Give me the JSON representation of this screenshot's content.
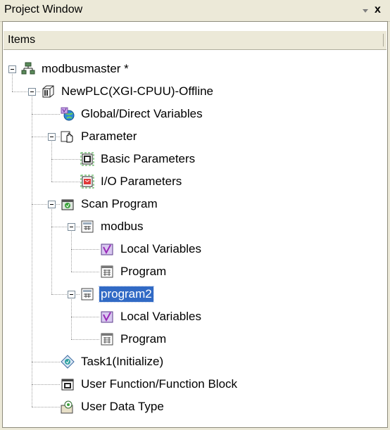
{
  "window": {
    "title": "Project Window",
    "close_glyph": "x",
    "pin_icon": "pin-dropdown-icon"
  },
  "header": {
    "items_label": "Items"
  },
  "tree": {
    "nodes": [
      {
        "id": "modbusmaster",
        "label": "modbusmaster *",
        "icon": "network-icon",
        "level": 0,
        "expanded": true
      },
      {
        "id": "newplc",
        "label": "NewPLC(XGI-CPUU)-Offline",
        "icon": "plc-icon",
        "level": 1,
        "expanded": true
      },
      {
        "id": "global-vars",
        "label": "Global/Direct Variables",
        "icon": "global-variables-icon",
        "level": 2
      },
      {
        "id": "parameter",
        "label": "Parameter",
        "icon": "parameter-hand-icon",
        "level": 2,
        "expanded": true
      },
      {
        "id": "basic-params",
        "label": "Basic Parameters",
        "icon": "basic-parameters-icon",
        "level": 3
      },
      {
        "id": "io-params",
        "label": "I/O Parameters",
        "icon": "io-parameters-icon",
        "level": 3
      },
      {
        "id": "scan-program",
        "label": "Scan Program",
        "icon": "scan-program-icon",
        "level": 2,
        "expanded": true
      },
      {
        "id": "modbus",
        "label": "modbus",
        "icon": "program-block-icon",
        "level": 3,
        "expanded": true
      },
      {
        "id": "modbus-local-vars",
        "label": "Local Variables",
        "icon": "local-variables-icon",
        "level": 4
      },
      {
        "id": "modbus-program",
        "label": "Program",
        "icon": "program-ladder-icon",
        "level": 4
      },
      {
        "id": "program2",
        "label": "program2",
        "icon": "program-block-icon",
        "level": 3,
        "expanded": true,
        "selected": true
      },
      {
        "id": "program2-local-vars",
        "label": "Local Variables",
        "icon": "local-variables-icon",
        "level": 4
      },
      {
        "id": "program2-program",
        "label": "Program",
        "icon": "program-ladder-icon",
        "level": 4
      },
      {
        "id": "task1",
        "label": "Task1(Initialize)",
        "icon": "task-icon",
        "level": 2
      },
      {
        "id": "user-fb",
        "label": "User Function/Function Block",
        "icon": "function-block-icon",
        "level": 2
      },
      {
        "id": "user-dt",
        "label": "User Data Type",
        "icon": "data-type-icon",
        "level": 2
      }
    ]
  },
  "colors": {
    "chrome": "#ece9d8",
    "selection": "#316ac5",
    "tree_line": "#a0a0a0"
  }
}
